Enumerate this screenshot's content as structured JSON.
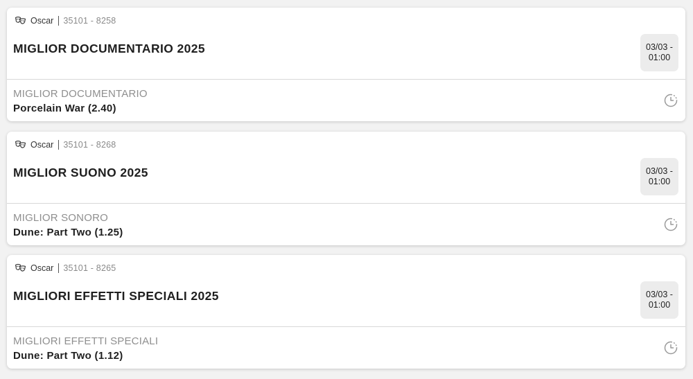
{
  "icons": {
    "sport": "oscar-masks-icon",
    "status": "clock-pending-icon"
  },
  "colors": {
    "background": "#f2f2f2",
    "card": "#ffffff",
    "date_box": "#ececec",
    "muted_text": "#8f8f8f"
  },
  "bets": [
    {
      "competition": "Oscar",
      "code": "35101 - 8258",
      "title": "MIGLIOR DOCUMENTARIO 2025",
      "date": "03/03 -",
      "time": "01:00",
      "market": "MIGLIOR DOCUMENTARIO",
      "selection": "Porcelain War (2.40)"
    },
    {
      "competition": "Oscar",
      "code": "35101 - 8268",
      "title": "MIGLIOR SUONO 2025",
      "date": "03/03 -",
      "time": "01:00",
      "market": "MIGLIOR SONORO",
      "selection": "Dune: Part Two (1.25)"
    },
    {
      "competition": "Oscar",
      "code": "35101 - 8265",
      "title": "MIGLIORI EFFETTI SPECIALI 2025",
      "date": "03/03 -",
      "time": "01:00",
      "market": "MIGLIORI EFFETTI SPECIALI",
      "selection": "Dune: Part Two (1.12)"
    }
  ]
}
